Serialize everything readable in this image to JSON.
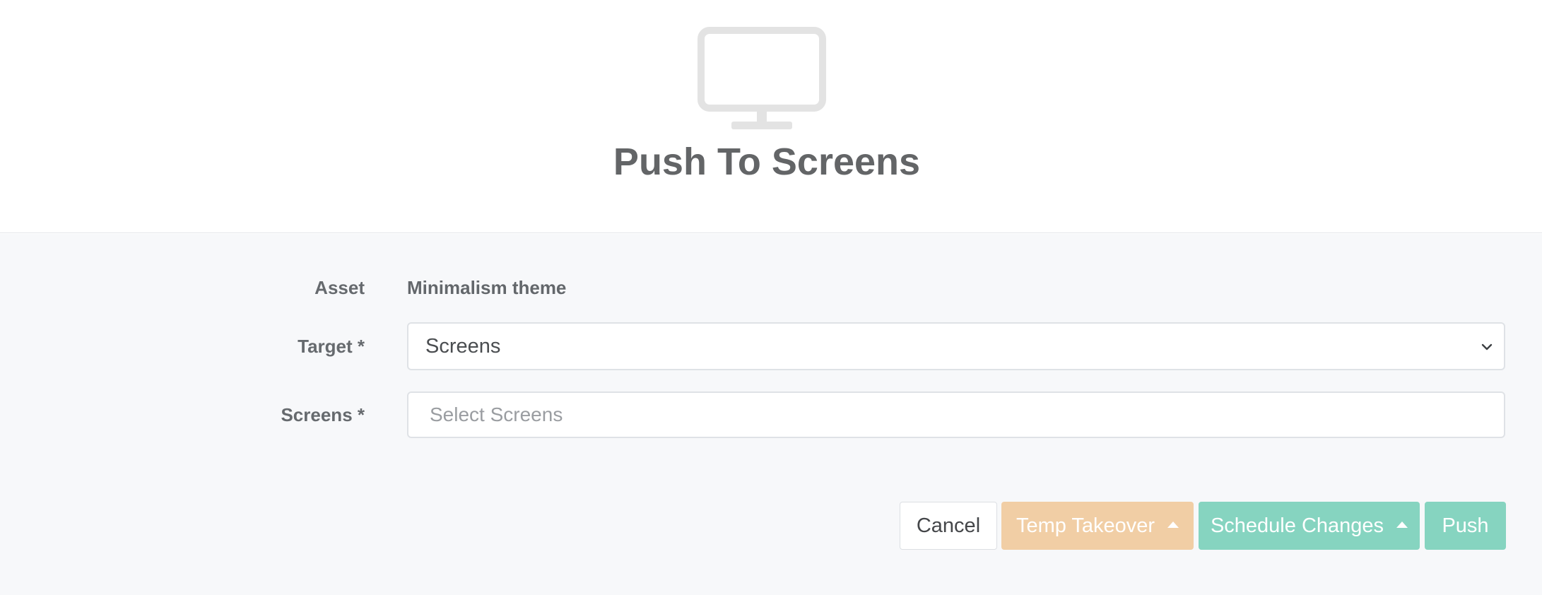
{
  "header": {
    "icon": "monitor-icon",
    "title": "Push To Screens"
  },
  "form": {
    "asset": {
      "label": "Asset",
      "value": "Minimalism theme"
    },
    "target": {
      "label": "Target *",
      "selected": "Screens"
    },
    "screens": {
      "label": "Screens *",
      "placeholder": "Select Screens"
    }
  },
  "actions": {
    "cancel_label": "Cancel",
    "temp_takeover_label": "Temp Takeover",
    "schedule_changes_label": "Schedule Changes",
    "push_label": "Push"
  },
  "colors": {
    "temp_takeover": "#f1cea5",
    "schedule": "#86d4c0",
    "push": "#86d4c0",
    "title": "#636567",
    "icon": "#e3e3e3"
  }
}
